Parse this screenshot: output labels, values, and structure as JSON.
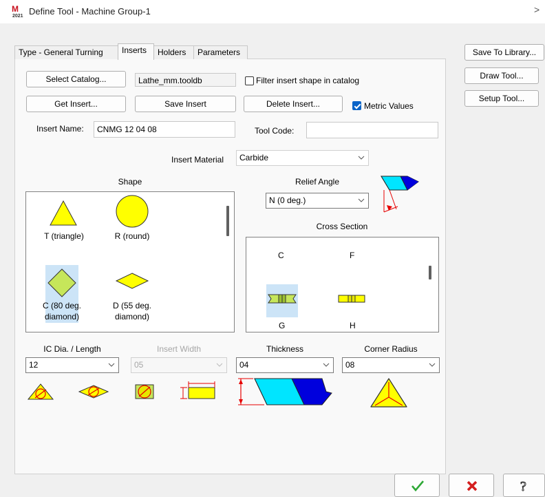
{
  "window": {
    "title": "Define Tool - Machine Group-1",
    "icon_year": "2021"
  },
  "tabs": [
    {
      "label": "Type - General Turning"
    },
    {
      "label": "Inserts"
    },
    {
      "label": "Holders"
    },
    {
      "label": "Parameters"
    }
  ],
  "right_buttons": {
    "save_library": "Save To Library...",
    "draw_tool": "Draw Tool...",
    "setup_tool": "Setup Tool..."
  },
  "row1": {
    "select_catalog": "Select Catalog...",
    "catalog_value": "Lathe_mm.tooldb",
    "filter_label": "Filter insert shape in catalog",
    "filter_checked": false
  },
  "row2": {
    "get_insert": "Get Insert...",
    "save_insert": "Save Insert",
    "delete_insert": "Delete Insert...",
    "metric_label": "Metric Values",
    "metric_checked": true
  },
  "row3": {
    "insert_name_label": "Insert Name:",
    "insert_name_value": "CNMG 12 04 08",
    "tool_code_label": "Tool Code:",
    "tool_code_value": ""
  },
  "material": {
    "label": "Insert Material",
    "value": "Carbide"
  },
  "shape": {
    "heading": "Shape",
    "items": [
      {
        "label": "T (triangle)",
        "selected": false
      },
      {
        "label": "R (round)",
        "selected": false
      },
      {
        "label": "C (80 deg.\ndiamond)",
        "selected": true
      },
      {
        "label": "D (55 deg.\ndiamond)",
        "selected": false
      }
    ]
  },
  "relief": {
    "heading": "Relief Angle",
    "value": "N (0 deg.)"
  },
  "cross_section": {
    "heading": "Cross Section",
    "top_labels": [
      "C",
      "F"
    ],
    "items": [
      {
        "label": "G",
        "selected": true
      },
      {
        "label": "H",
        "selected": false
      }
    ]
  },
  "dims": {
    "ic_label": "IC Dia. / Length",
    "ic_value": "12",
    "width_label": "Insert Width",
    "width_value": "05",
    "thickness_label": "Thickness",
    "thickness_value": "04",
    "radius_label": "Corner Radius",
    "radius_value": "08"
  },
  "colors": {
    "insert_yellow": "#ffff00",
    "selected_green": "#c6e65a",
    "cyan": "#00e5ff",
    "blue": "#0000dd",
    "dim_red": "#e60000",
    "ok_green": "#2ea836",
    "cancel_red": "#d41e1e"
  },
  "bottom": {
    "ok_icon": "checkmark-icon",
    "cancel_icon": "x-icon",
    "help_icon": "question-icon"
  }
}
